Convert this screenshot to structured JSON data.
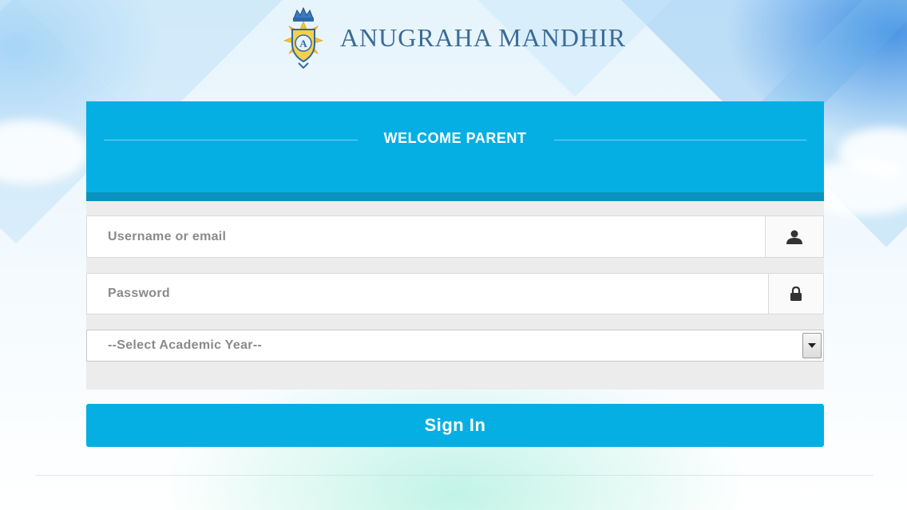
{
  "header": {
    "brand_name": "ANUGRAHA MANDHIR"
  },
  "login_panel": {
    "title": "WELCOME PARENT",
    "username": {
      "placeholder": "Username or email",
      "icon": "user-icon"
    },
    "password": {
      "placeholder": "Password",
      "icon": "lock-icon"
    },
    "academic_year": {
      "selected": "--Select Academic Year--",
      "icon": "dropdown-arrow-icon"
    },
    "signin_label": "Sign In"
  },
  "colors": {
    "accent": "#06afe3",
    "accent_dark": "#0a93c1",
    "brand_text": "#3b6b97"
  }
}
